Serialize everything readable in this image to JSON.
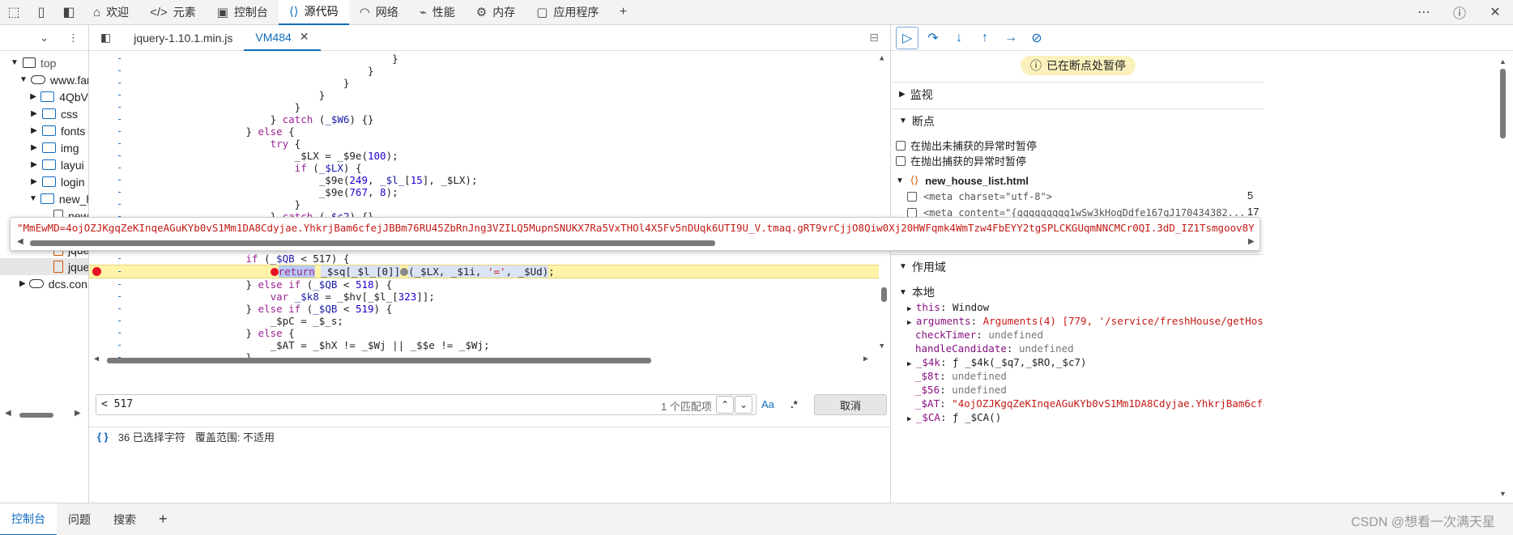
{
  "topbar": {
    "tabs": [
      {
        "label": "欢迎",
        "icon": "home-icon",
        "glyph": "⌂"
      },
      {
        "label": "元素",
        "icon": "code-icon",
        "glyph": "</>"
      },
      {
        "label": "控制台",
        "icon": "console-icon",
        "glyph": "▣"
      },
      {
        "label": "源代码",
        "icon": "sources-icon",
        "glyph": "⟨⟩"
      },
      {
        "label": "网络",
        "icon": "wifi-icon",
        "glyph": "◠"
      },
      {
        "label": "性能",
        "icon": "performance-icon",
        "glyph": "⌁"
      },
      {
        "label": "内存",
        "icon": "memory-icon",
        "glyph": "⚙"
      },
      {
        "label": "应用程序",
        "icon": "application-icon",
        "glyph": "▢"
      }
    ],
    "active_tab": "源代码",
    "add_tab_glyph": "+"
  },
  "navigator": {
    "items": [
      {
        "label": "top",
        "type": "frame",
        "depth": 0,
        "expanded": true
      },
      {
        "label": "www.fan",
        "type": "cloud",
        "depth": 1,
        "expanded": true
      },
      {
        "label": "4QbV",
        "type": "folder",
        "depth": 2
      },
      {
        "label": "css",
        "type": "folder",
        "depth": 2
      },
      {
        "label": "fonts",
        "type": "folder",
        "depth": 2
      },
      {
        "label": "img",
        "type": "folder",
        "depth": 2
      },
      {
        "label": "layui",
        "type": "folder",
        "depth": 2
      },
      {
        "label": "login",
        "type": "folder",
        "depth": 2
      },
      {
        "label": "new_h",
        "type": "folder",
        "depth": 2,
        "expanded": true
      },
      {
        "label": "new",
        "type": "file",
        "depth": 3
      },
      {
        "label": "fres",
        "type": "file-js",
        "depth": 3
      },
      {
        "label": "jque",
        "type": "file-js",
        "depth": 3,
        "selected": true
      },
      {
        "label": "dcs.cona",
        "type": "cloud",
        "depth": 1
      }
    ]
  },
  "editor": {
    "file_tabs": [
      {
        "label": "jquery-1.10.1.min.js",
        "active": false
      },
      {
        "label": "VM484",
        "active": true
      }
    ],
    "search": {
      "value": "< 517",
      "match_count": "1 个匹配项",
      "case_label": "Aa",
      "regex_label": ".*",
      "cancel_label": "取消"
    },
    "status": {
      "braces": "{ }",
      "selected": "36 已选择字符",
      "coverage": "覆盖范围: 不适用"
    }
  },
  "debugger": {
    "paused_label": "已在断点处暂停",
    "watch_label": "监视",
    "breakpoints_label": "断点",
    "pause_uncaught": "在抛出未捕获的异常时暂停",
    "pause_caught": "在抛出捕获的异常时暂停",
    "bp_file": "new_house_list.html",
    "bp_rows": [
      {
        "code": "<meta charset=\"utf-8\">",
        "line": "5"
      },
      {
        "code": "<meta content=\"{qqqqqqqqq1wSw3kHogDdfe167qJ170434382...",
        "line": "17"
      }
    ],
    "scope_label": "作用域",
    "local_label": "本地",
    "scope_items": [
      {
        "key": "this",
        "value": "Window",
        "expandable": true
      },
      {
        "key": "arguments",
        "value": "Arguments(4) [779, '/service/freshHouse/getHosueLi",
        "expandable": true
      },
      {
        "key": "checkTimer",
        "value": "undefined"
      },
      {
        "key": "handleCandidate",
        "value": "undefined"
      },
      {
        "key": "_$4k",
        "value": "ƒ _$4k(_$q7,_$RO,_$c7)",
        "expandable": true
      },
      {
        "key": "_$8t",
        "value": "undefined"
      },
      {
        "key": "_$56",
        "value": "undefined"
      },
      {
        "key": "_$AT",
        "value": "\"4ojOZJKgqZeKInqeAGuKYb0vS1Mm1DA8Cdyjae.YhkrjBam6cfejJB"
      },
      {
        "key": "_$CA",
        "value": "ƒ _$CA()",
        "expandable": true
      }
    ]
  },
  "tooltip": {
    "value": "\"MmEwMD=4ojOZJKgqZeKInqeAGuKYb0vS1Mm1DA8Cdyjae.YhkrjBam6cfejJBBm76RU45ZbRnJng3VZILQ5MupnSNUKX7Ra5VxTHOl4X5Fv5nDUqk6UTI9U_V.tmaq.gRT9vrCjjO8Qiw0Xj20HWFqmk4WmTzw4FbEYY2tgSPLCKGUqmNNCMCr0QI.3dD_IZ1Tsmgoov8YYgsU1omgm4Pc0MsyoJE"
  },
  "drawer": {
    "tabs": [
      "控制台",
      "问题",
      "搜索"
    ],
    "active_tab": "控制台",
    "add_glyph": "+"
  },
  "watermark": "CSDN @想看一次满天星",
  "colors": {
    "accent": "#0f6cbd",
    "highlight_line": "#fff3a8",
    "paused_banner": "#fbf1bd",
    "breakpoint": "#e81123"
  }
}
